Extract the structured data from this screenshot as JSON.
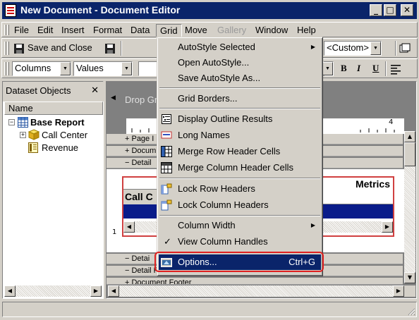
{
  "window": {
    "title": "New Document - Document Editor",
    "controls": {
      "minimize": "_",
      "maximize": "□",
      "close": "✕"
    }
  },
  "menubar": {
    "items": [
      "File",
      "Edit",
      "Insert",
      "Format",
      "Data",
      "Grid",
      "Move",
      "Gallery",
      "Window",
      "Help"
    ],
    "open_item": "Grid",
    "disabled_item": "Gallery"
  },
  "toolbar1": {
    "save_close_label": "Save and Close",
    "style_combo_value": "<Custom>"
  },
  "toolbar2": {
    "columns_combo": "Columns",
    "values_combo": "Values",
    "format_buttons": [
      "B",
      "I",
      "U"
    ]
  },
  "left_pane": {
    "title": "Dataset Objects",
    "column_header": "Name",
    "tree": [
      {
        "label": "Base Report",
        "level": 0,
        "expander": "−",
        "icon": "grid-report-icon"
      },
      {
        "label": "Call Center",
        "level": 1,
        "expander": "+",
        "icon": "attribute-cube-icon"
      },
      {
        "label": "Revenue",
        "level": 1,
        "expander": "",
        "icon": "metric-icon"
      }
    ]
  },
  "right_pane": {
    "drop_zone_text": "Drop Gr",
    "bands": [
      {
        "label": "+ Page I"
      },
      {
        "label": "+ Docum"
      },
      {
        "label": "− Detail"
      }
    ],
    "grid_header_left": "Call C",
    "grid_header_right": "Metrics",
    "lower_bands": [
      {
        "label": "− Detai"
      },
      {
        "label": "− Detail Footer"
      },
      {
        "label": "+ Document Footer"
      }
    ],
    "ruler_mark": "4",
    "ruler_left_mark": "1"
  },
  "dropdown": {
    "items": [
      {
        "label": "AutoStyle Selected",
        "submenu": true,
        "icon": ""
      },
      {
        "label": "Open AutoStyle...",
        "icon": ""
      },
      {
        "label": "Save AutoStyle As...",
        "icon": ""
      },
      {
        "separator": true
      },
      {
        "label": "Grid Borders...",
        "icon": ""
      },
      {
        "separator": true
      },
      {
        "label": "Display Outline Results",
        "icon": "outline-icon"
      },
      {
        "label": "Long Names",
        "icon": "long-names-icon"
      },
      {
        "label": "Merge Row Header Cells",
        "icon": "merge-row-icon"
      },
      {
        "label": "Merge Column Header Cells",
        "icon": "merge-column-icon"
      },
      {
        "separator": true
      },
      {
        "label": "Lock Row Headers",
        "icon": "lock-row-icon"
      },
      {
        "label": "Lock Column Headers",
        "icon": "lock-column-icon"
      },
      {
        "separator": true
      },
      {
        "label": "Column Width",
        "submenu": true,
        "icon": ""
      },
      {
        "label": "View Column Handles",
        "checked": true,
        "icon": "checkmark-icon"
      },
      {
        "separator": true
      },
      {
        "label": "Options...",
        "accelerator": "Ctrl+G",
        "highlighted": true,
        "icon": "options-icon"
      }
    ]
  },
  "colors": {
    "titlebar": "#0a246a",
    "face": "#d4d0c8",
    "highlight": "#0a246a",
    "annotation_ring": "#e02020"
  }
}
